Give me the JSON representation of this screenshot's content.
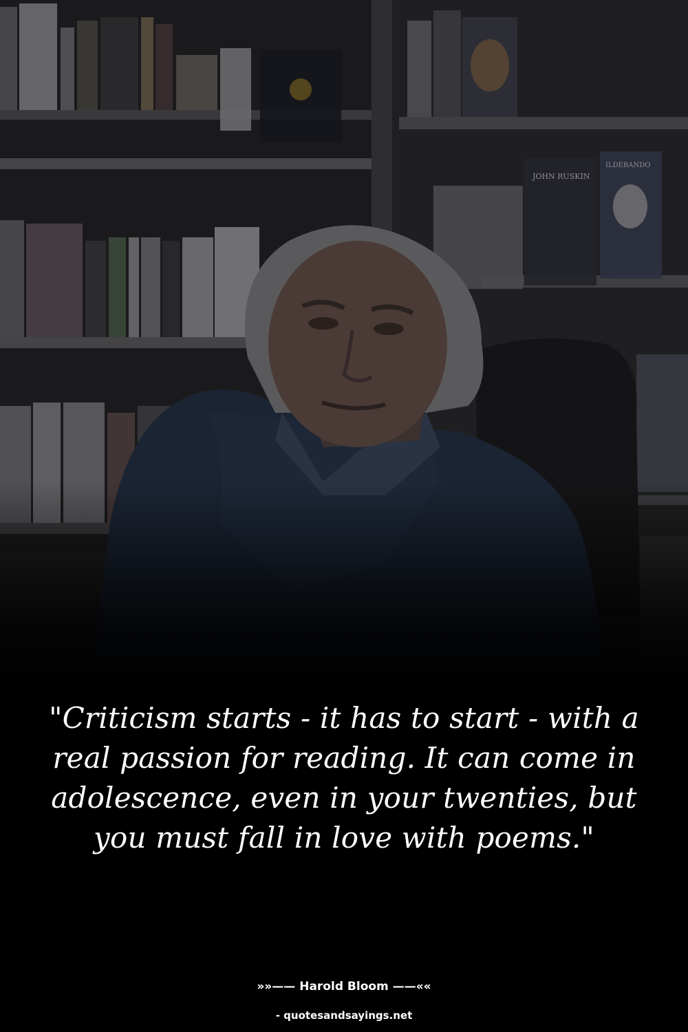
{
  "photo": {
    "description_icon": "portrait-photo",
    "book_spine_texts": [
      "JOHN RUSKIN",
      "ILDEBANDO"
    ]
  },
  "quote": {
    "text": "\"Criticism starts - it has to start - with a real passion for reading. It can come in adolescence, even in your twenties, but you must fall in love with poems.\""
  },
  "attribution": {
    "author_line": "»»—— Harold Bloom ——««",
    "source": "- quotesandsayings.net"
  },
  "colors": {
    "background": "#000000",
    "text": "#ffffff"
  }
}
